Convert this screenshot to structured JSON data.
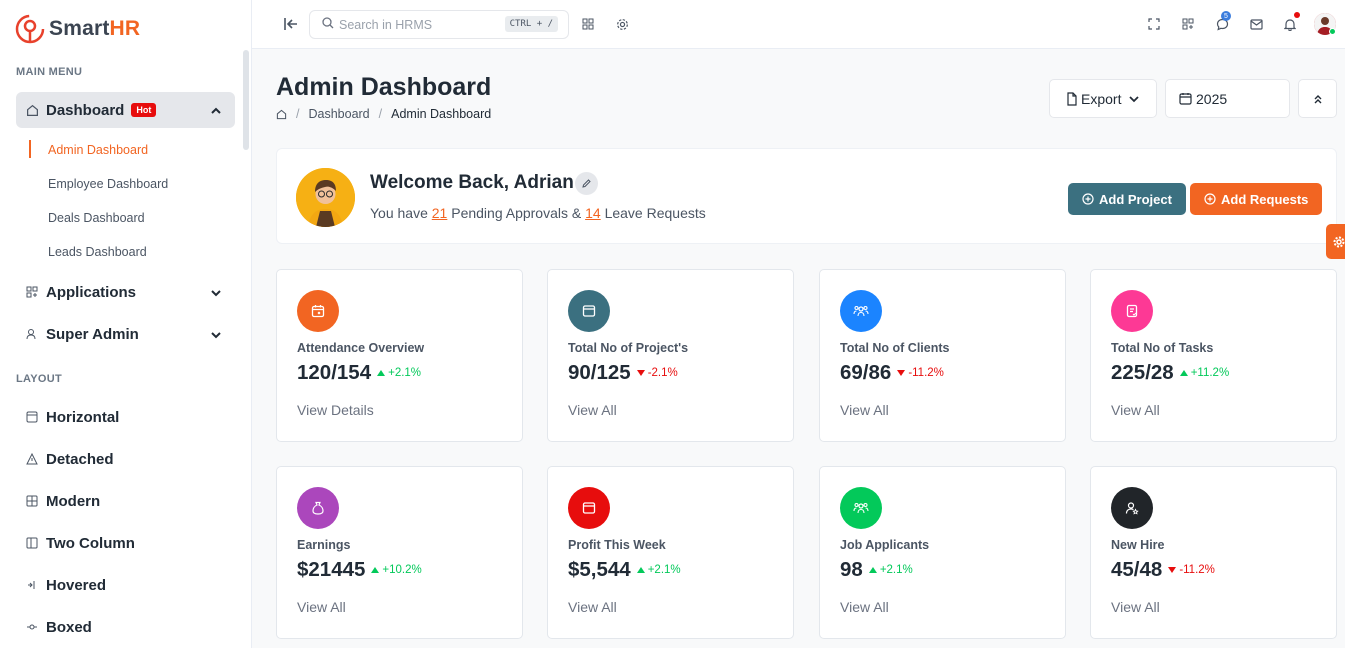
{
  "app": {
    "name_part1": "Smart",
    "name_part2": "HR"
  },
  "sidebar": {
    "main_menu_title": "MAIN MENU",
    "dashboard": {
      "label": "Dashboard",
      "badge": "Hot"
    },
    "dashboard_sub": [
      "Admin Dashboard",
      "Employee Dashboard",
      "Deals Dashboard",
      "Leads Dashboard"
    ],
    "applications": "Applications",
    "super_admin": "Super Admin",
    "layout_title": "LAYOUT",
    "layout_items": [
      "Horizontal",
      "Detached",
      "Modern",
      "Two Column",
      "Hovered",
      "Boxed"
    ]
  },
  "topbar": {
    "search_placeholder": "Search in HRMS",
    "search_shortcut": "CTRL + /",
    "chat_count": "5"
  },
  "page": {
    "title": "Admin Dashboard",
    "breadcrumb": [
      "Dashboard",
      "Admin Dashboard"
    ],
    "export_label": "Export",
    "year": "2025"
  },
  "welcome": {
    "title": "Welcome Back, Adrian",
    "sub_prefix": "You have ",
    "pending_count": "21",
    "sub_middle": " Pending Approvals & ",
    "leave_count": "14",
    "sub_suffix": " Leave Requests",
    "add_project": "Add Project",
    "add_requests": "Add Requests"
  },
  "cards": [
    {
      "label": "Attendance Overview",
      "value": "120/154",
      "delta": "+2.1%",
      "trend": "up",
      "link": "View Details",
      "color": "#f26522"
    },
    {
      "label": "Total No of Project's",
      "value": "90/125",
      "delta": "-2.1%",
      "trend": "down",
      "link": "View All",
      "color": "#3b7080"
    },
    {
      "label": "Total No of Clients",
      "value": "69/86",
      "delta": "-11.2%",
      "trend": "down",
      "link": "View All",
      "color": "#1b84ff"
    },
    {
      "label": "Total No of Tasks",
      "value": "225/28",
      "delta": "+11.2%",
      "trend": "up",
      "link": "View All",
      "color": "#fd3995"
    },
    {
      "label": "Earnings",
      "value": "$21445",
      "delta": "+10.2%",
      "trend": "up",
      "link": "View All",
      "color": "#ab47bc"
    },
    {
      "label": "Profit This Week",
      "value": "$5,544",
      "delta": "+2.1%",
      "trend": "up",
      "link": "View All",
      "color": "#e70d0d"
    },
    {
      "label": "Job Applicants",
      "value": "98",
      "delta": "+2.1%",
      "trend": "up",
      "link": "View All",
      "color": "#03c95a"
    },
    {
      "label": "New Hire",
      "value": "45/48",
      "delta": "-11.2%",
      "trend": "down",
      "link": "View All",
      "color": "#212529"
    }
  ],
  "colors": {
    "accent": "#f26522",
    "secondary": "#3b7080",
    "success": "#03c95a",
    "danger": "#e70d0d"
  }
}
